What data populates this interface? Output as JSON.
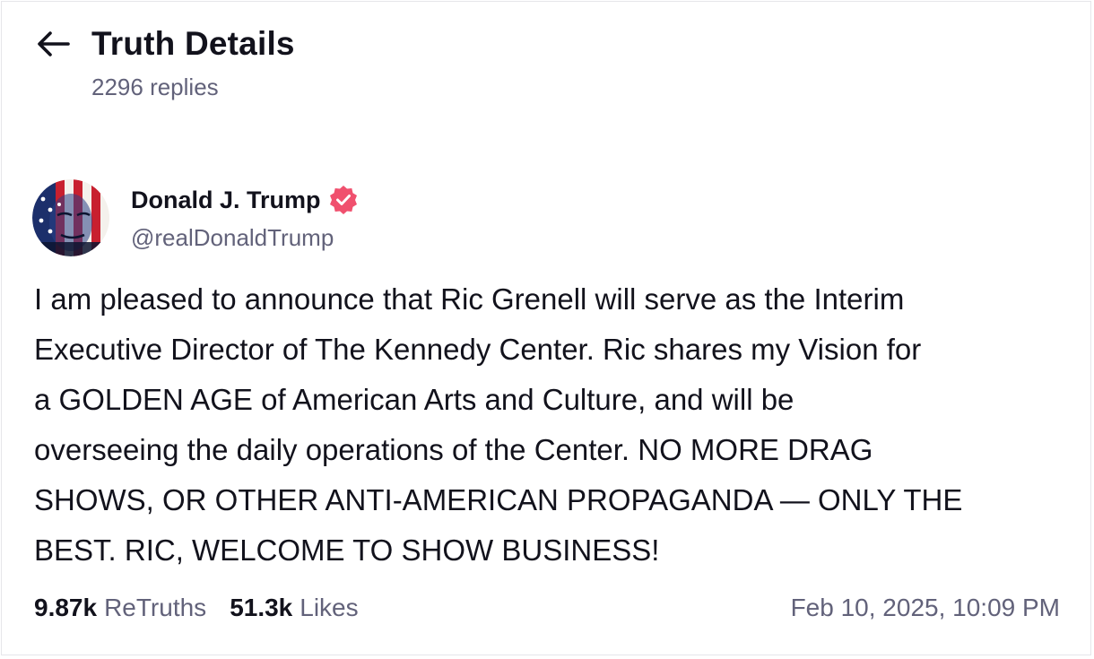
{
  "header": {
    "title": "Truth Details",
    "replies": "2296 replies",
    "back_icon": "arrow-left-icon"
  },
  "post": {
    "author": {
      "display_name": "Donald J. Trump",
      "handle": "@realDonaldTrump",
      "verified": true,
      "verified_color": "#f0506e",
      "avatar_icon": "flag-portrait-avatar"
    },
    "body": "I am pleased to announce that Ric Grenell will serve as the Interim\nExecutive Director of The Kennedy Center. Ric shares my Vision for\na GOLDEN AGE of American Arts and Culture, and will be\noverseeing the daily operations of the Center. NO MORE DRAG\nSHOWS, OR OTHER ANTI-AMERICAN PROPAGANDA — ONLY THE\nBEST. RIC, WELCOME TO SHOW BUSINESS!",
    "stats": {
      "retruths_count": "9.87k",
      "retruths_label": "ReTruths",
      "likes_count": "51.3k",
      "likes_label": "Likes"
    },
    "timestamp": "Feb 10, 2025, 10:09 PM"
  },
  "colors": {
    "text_primary": "#12121c",
    "text_secondary": "#62627a",
    "border": "#e6e6ea"
  }
}
